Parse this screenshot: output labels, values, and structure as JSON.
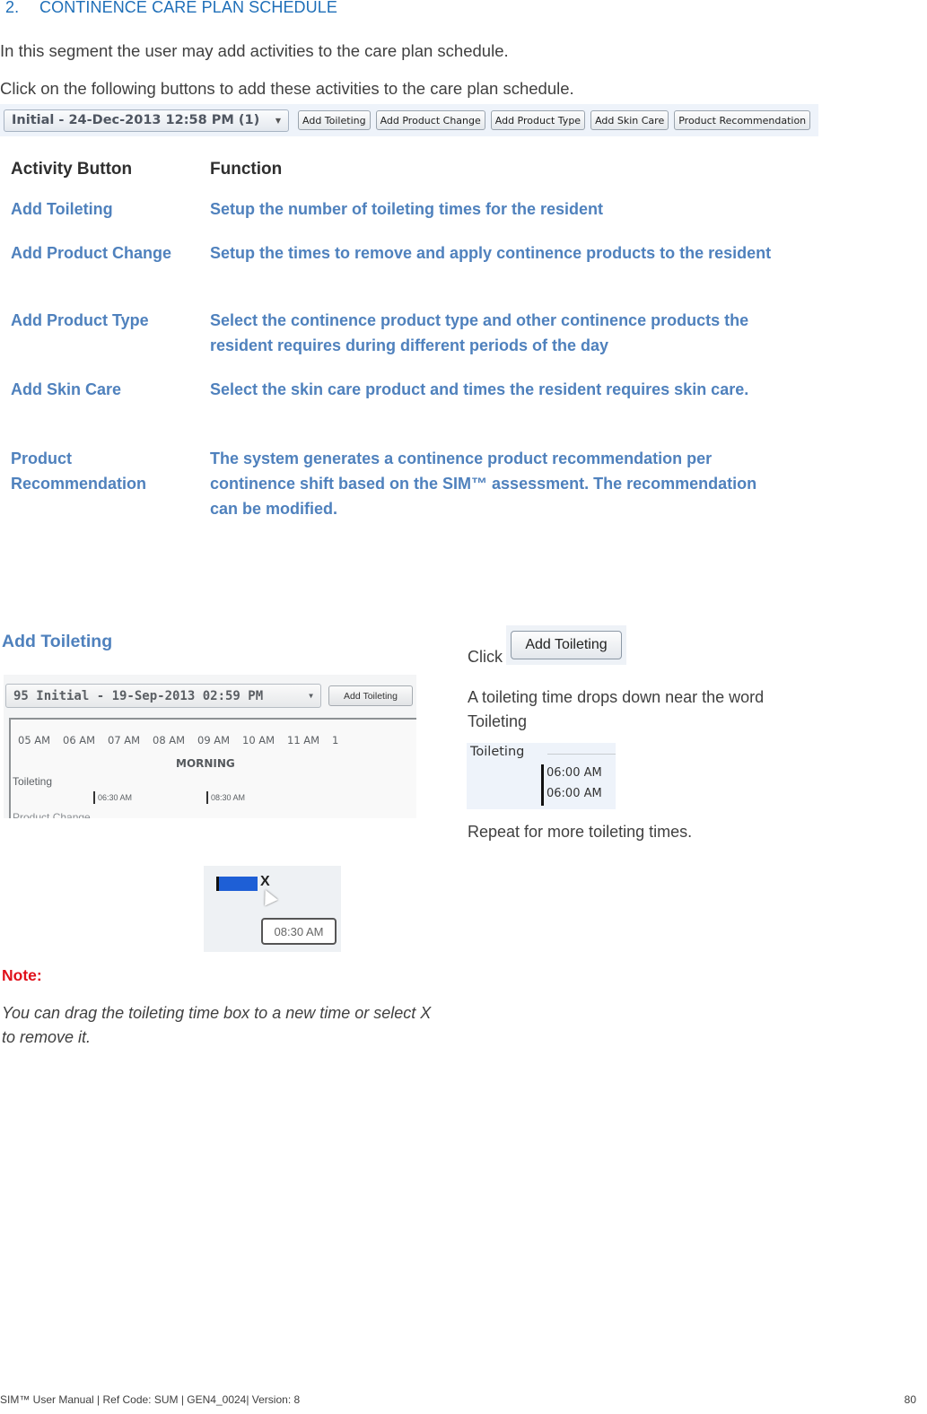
{
  "heading": {
    "number": "2.",
    "title": "CONTINENCE CARE PLAN SCHEDULE"
  },
  "intro": [
    "In this segment the user may add activities to the care plan schedule.",
    "Click on the following buttons to add these activities to the care plan schedule."
  ],
  "toolbar": {
    "plan_select": "Initial - 24-Dec-2013 12:58 PM (1)",
    "buttons": [
      "Add Toileting",
      "Add Product Change",
      "Add Product Type",
      "Add Skin Care",
      "Product Recommendation"
    ]
  },
  "table": {
    "headers": [
      "Activity Button",
      "Function"
    ],
    "rows": [
      {
        "button": "Add Toileting",
        "function": "Setup the number of toileting times for the resident"
      },
      {
        "button": "Add Product Change",
        "function": "Setup  the times to remove and apply continence products to the resident"
      },
      {
        "button": "Add Product Type",
        "function": "Select the continence product type and other continence products the resident requires during different periods of the day"
      },
      {
        "button": "Add Skin Care",
        "function": "Select the skin care product and times the resident requires skin care."
      },
      {
        "button": "Product Recommendation",
        "function": "The system generates a continence product recommendation per continence shift based on the SIM™ assessment. The recommendation can be modified."
      }
    ]
  },
  "section": {
    "title": "Add Toileting",
    "schedule": {
      "plan_select": "95 Initial - 19-Sep-2013 02:59 PM",
      "add_button": "Add Toileting",
      "hours": [
        "05 AM",
        "06 AM",
        "07 AM",
        "08 AM",
        "09 AM",
        "10 AM",
        "11 AM",
        "1"
      ],
      "period": "MORNING",
      "row_label": "Toileting",
      "times": [
        "06:30 AM",
        "08:30 AM"
      ],
      "next_row": "Product Change"
    },
    "drag": {
      "x_label": "X",
      "tooltip": "08:30 AM"
    },
    "note_label": "Note:",
    "note_text": "You can drag the toileting time box to a new time or select X to remove it.",
    "click_label": "Click",
    "click_button": "Add Toileting",
    "description": "A toileting time drops down near the word Toileting",
    "toileting_preview": {
      "label": "Toileting",
      "times": [
        "06:00 AM",
        "06:00 AM"
      ]
    },
    "repeat": "Repeat for more toileting times."
  },
  "footer": {
    "text": "SIM™ User Manual | Ref Code: SUM | GEN4_0024| Version: 8",
    "page": "80"
  }
}
